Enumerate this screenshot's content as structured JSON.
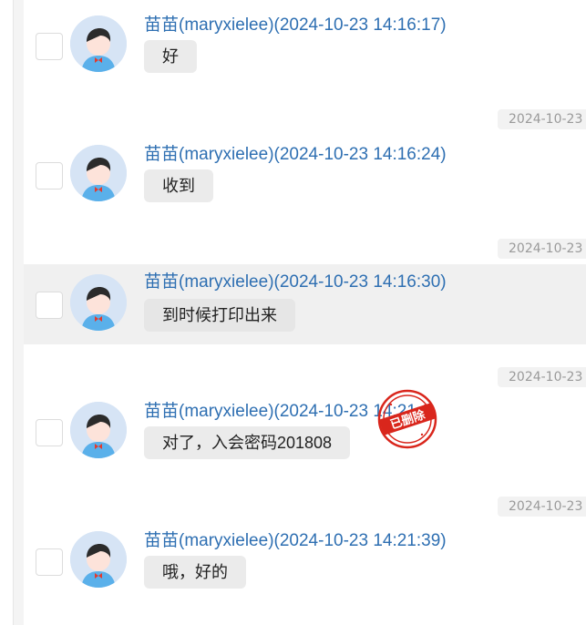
{
  "messages": [
    {
      "sender": "苗苗(maryxielee)(2024-10-23 14:16:17)",
      "text": "好",
      "selected": false
    },
    {
      "sender": "苗苗(maryxielee)(2024-10-23 14:16:24)",
      "text": "收到",
      "selected": false
    },
    {
      "sender": "苗苗(maryxielee)(2024-10-23 14:16:30)",
      "text": "到时候打印出来",
      "selected": true
    },
    {
      "sender": "苗苗(maryxielee)(2024-10-23 14:21:",
      "text": "对了，入会密码201808",
      "selected": false,
      "deleted": true
    },
    {
      "sender": "苗苗(maryxielee)(2024-10-23 14:21:39)",
      "text": "哦，好的",
      "selected": false
    }
  ],
  "time_chips": [
    "2024-10-23",
    "2024-10-23",
    "2024-10-23",
    "2024-10-23"
  ],
  "stamp": {
    "text": "已删除",
    "color": "#d9261c"
  },
  "colors": {
    "sender": "#2e6fb2",
    "bubble": "#ebebeb",
    "selected_row": "#f0f0f0",
    "time_chip": "#f2f2f2",
    "time_text": "#9a9a9a"
  },
  "icons": {
    "avatar": "default-boy-avatar-icon",
    "stamp": "deleted-stamp-icon"
  }
}
